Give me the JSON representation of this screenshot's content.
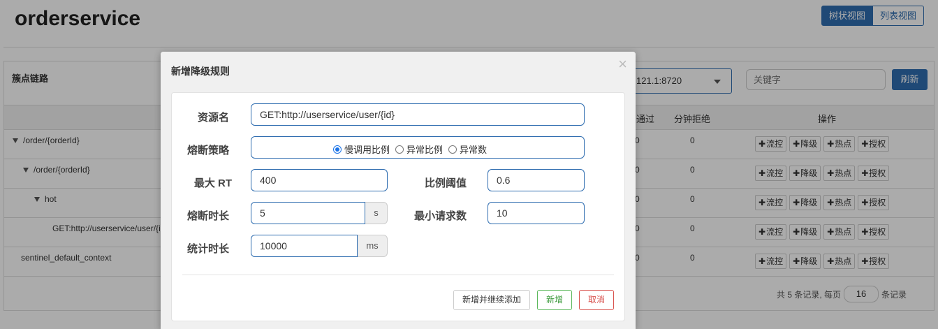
{
  "page": {
    "title": "orderservice"
  },
  "view_toggle": {
    "tree": "树状视图",
    "list": "列表视图"
  },
  "panel": {
    "title": "簇点链路",
    "machine_value": "121.1:8720",
    "keyword_placeholder": "关键字",
    "refresh": "刷新"
  },
  "table": {
    "headers": {
      "pass": "通过",
      "block": "分钟拒绝",
      "ops": "操作"
    },
    "rows": [
      {
        "name": "/order/{orderId}",
        "pass": "0",
        "block": "0"
      },
      {
        "name": "/order/{orderId}",
        "pass": "0",
        "block": "0"
      },
      {
        "name": "hot",
        "pass": "0",
        "block": "0"
      },
      {
        "name": "GET:http://userservice/user/{i",
        "pass": "0",
        "block": "0"
      },
      {
        "name": "sentinel_default_context",
        "pass": "0",
        "block": "0"
      }
    ],
    "ops": {
      "flow": "流控",
      "degrade": "降级",
      "hot": "热点",
      "auth": "授权",
      "plus": "✚"
    }
  },
  "pager": {
    "prefix": "共 5 条记录, 每页",
    "size": "16",
    "suffix": "条记录"
  },
  "modal": {
    "title": "新增降级规则",
    "close": "×",
    "resource_label": "资源名",
    "resource_value": "GET:http://userservice/user/{id}",
    "strategy_label": "熔断策略",
    "strategy_options": [
      "慢调用比例",
      "异常比例",
      "异常数"
    ],
    "max_rt_label": "最大 RT",
    "max_rt_value": "400",
    "ratio_label": "比例阈值",
    "ratio_value": "0.6",
    "duration_label": "熔断时长",
    "duration_value": "5",
    "duration_unit": "s",
    "min_req_label": "最小请求数",
    "min_req_value": "10",
    "stat_label": "统计时长",
    "stat_value": "10000",
    "stat_unit": "ms",
    "btn_save_continue": "新增并继续添加",
    "btn_add": "新增",
    "btn_cancel": "取消"
  }
}
